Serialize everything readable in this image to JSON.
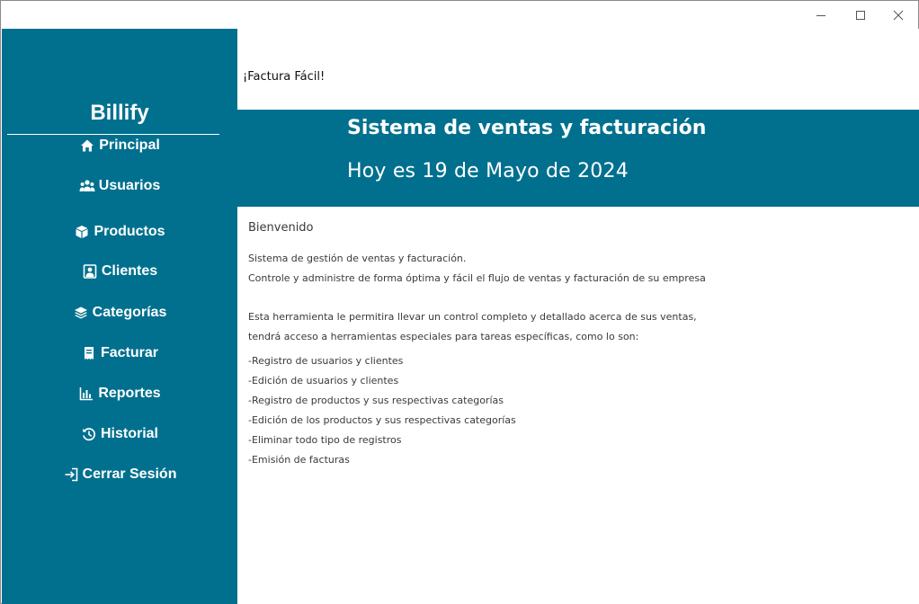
{
  "sidebar": {
    "brand": "Billify",
    "items": [
      {
        "label": "Principal",
        "icon": "home-icon"
      },
      {
        "label": "Usuarios",
        "icon": "users-icon"
      },
      {
        "label": "Productos",
        "icon": "box-icon"
      },
      {
        "label": "Clientes",
        "icon": "client-icon"
      },
      {
        "label": "Categorías",
        "icon": "layers-icon"
      },
      {
        "label": "Facturar",
        "icon": "receipt-icon"
      },
      {
        "label": "Reportes",
        "icon": "chart-icon"
      },
      {
        "label": "Historial",
        "icon": "history-icon"
      },
      {
        "label": "Cerrar Sesión",
        "icon": "logout-icon"
      }
    ]
  },
  "header": {
    "tagline": "¡Factura Fácil!",
    "title": "Sistema de ventas y facturación",
    "date": "Hoy es 19 de Mayo de 2024"
  },
  "content": {
    "welcome": "Bienvenido",
    "paragraph1": [
      "Sistema de gestión de ventas y facturación.",
      "Controle y administre de forma óptima y fácil el flujo de ventas y facturación de su empresa"
    ],
    "paragraph2": [
      "Esta herramienta le permitira llevar un control completo y detallado acerca de sus ventas,",
      "tendrá acceso a herramientas especiales para tareas específicas, como lo son:"
    ],
    "features": [
      "-Registro de usuarios y clientes",
      "-Edición de usuarios y clientes",
      "-Registro de productos y sus respectivas categorías",
      "-Edición de los productos y sus respectivas categorías",
      "-Eliminar todo tipo de registros",
      "-Emisión de facturas"
    ]
  },
  "colors": {
    "primary": "#01708e",
    "text_light": "#ffffff",
    "text_dark": "#3a3a3a"
  }
}
